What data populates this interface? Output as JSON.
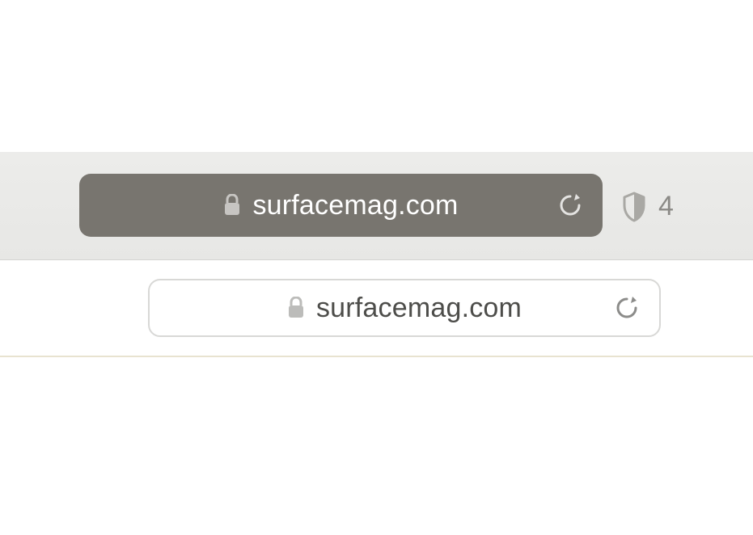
{
  "toolbar": {
    "address_dark": {
      "url": "surfacemag.com"
    },
    "privacy": {
      "tracker_count": "4"
    }
  },
  "content": {
    "address_light": {
      "url": "surfacemag.com"
    }
  }
}
